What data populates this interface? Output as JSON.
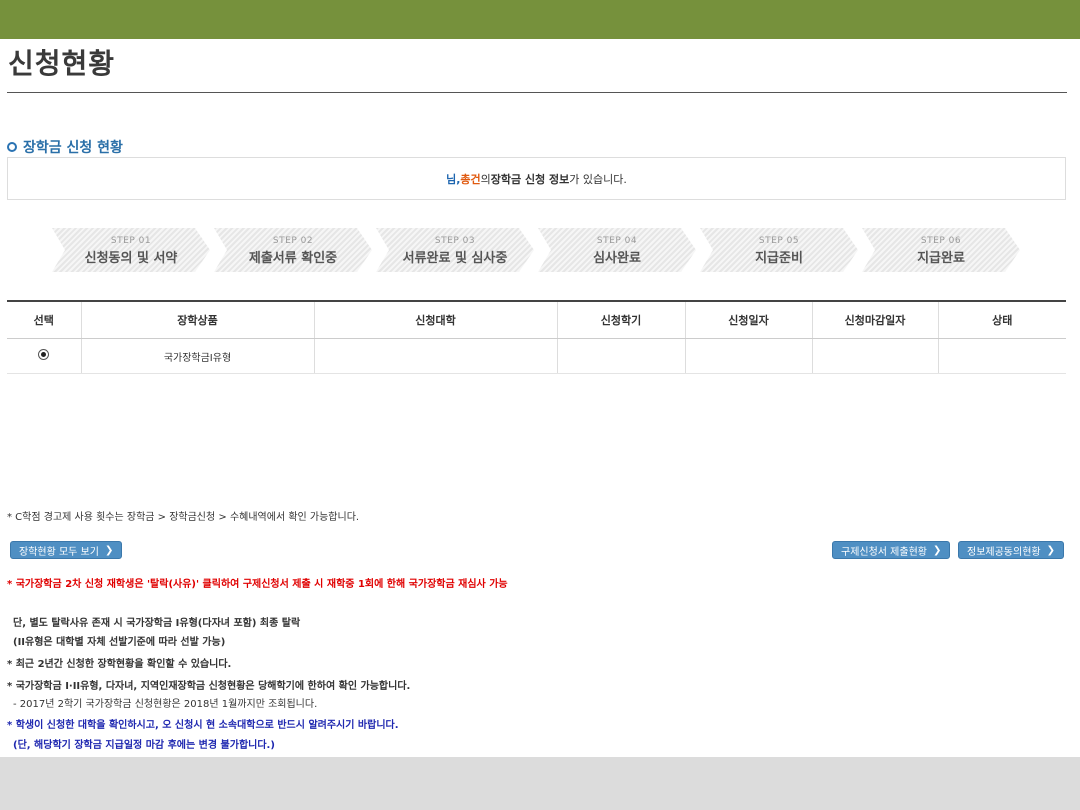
{
  "page": {
    "title": "신청현황"
  },
  "section": {
    "title": "장학금 신청 현황"
  },
  "info": {
    "suffix_name": "님, ",
    "total": "총",
    "count_word": " 건",
    "of": "의 ",
    "product": "장학금 신청 정보",
    "ending": "가 있습니다."
  },
  "steps": [
    {
      "no": "STEP 01",
      "label": "신청동의 및 서약"
    },
    {
      "no": "STEP 02",
      "label": "제출서류 확인중"
    },
    {
      "no": "STEP 03",
      "label": "서류완료 및 심사중"
    },
    {
      "no": "STEP 04",
      "label": "심사완료"
    },
    {
      "no": "STEP 05",
      "label": "지급준비"
    },
    {
      "no": "STEP 06",
      "label": "지급완료"
    }
  ],
  "table": {
    "headers": [
      "선택",
      "장학상품",
      "신청대학",
      "신청학기",
      "신청일자",
      "신청마감일자",
      "상태"
    ],
    "rows": [
      {
        "product": "국가장학금I유형",
        "university": "",
        "semester": "",
        "date": "",
        "deadline": "",
        "status": ""
      }
    ]
  },
  "notice_small": "* C학점 경고제 사용 횟수는 장학금 > 장학금신청 > 수혜내역에서 확인 가능합니다.",
  "buttons": {
    "view_all": "장학현황 모두 보기",
    "relief_status": "구제신청서 제출현황",
    "info_consent": "정보제공동의현황"
  },
  "notes": {
    "red": "* 국가장학금 2차 신청 재학생은 '탈락(사유)' 클릭하여 구제신청서 제출 시 재학중 1회에 한해 국가장학금 재심사 가능",
    "line1": "단, 별도 탈락사유 존재 시 국가장학금 I유형(다자녀 포함) 최종 탈락",
    "line2": "(II유형은 대학별 자체 선발기준에 따라 선발 가능)",
    "line3": "* 최근 2년간 신청한 장학현황을 확인할 수 있습니다.",
    "line4": "* 국가장학금 I·II유형, 다자녀, 지역인재장학금 신청현황은 당해학기에 한하여 확인 가능합니다.",
    "line5": "- 2017년 2학기 국가장학금 신청현황은 2018년 1월까지만 조회됩니다.",
    "line6": "* 학생이 신청한 대학을 확인하시고, 오 신청시 현 소속대학으로 반드시 알려주시기 바랍니다.",
    "line7": "(단, 해당학기 장학금 지급일정 마감 후에는 변경 불가합니다.)"
  },
  "colors": {
    "topbar": "#76913c",
    "button": "#4f8fc3",
    "red_note": "#e00000",
    "navy_note": "#1f28b0"
  }
}
